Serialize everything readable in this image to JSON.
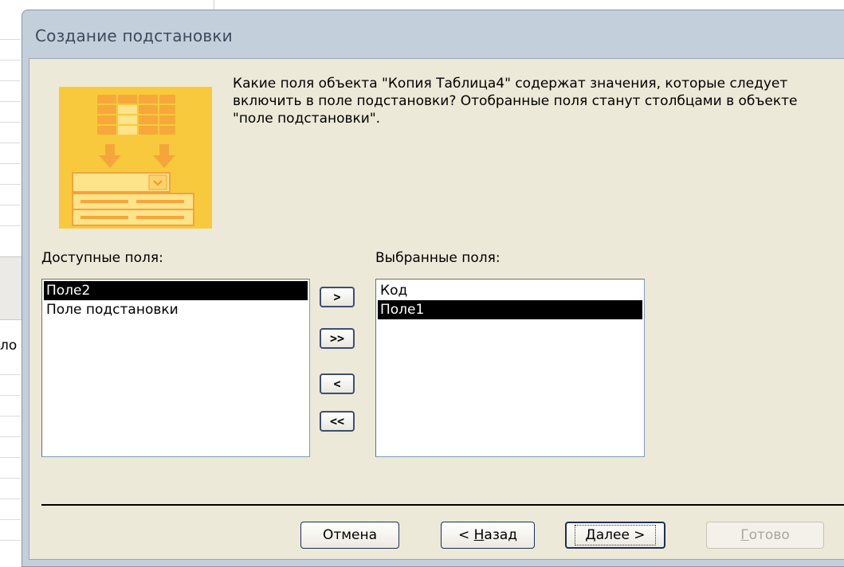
{
  "dialog": {
    "title": "Создание подстановки",
    "question": "Какие поля объекта \"Копия Таблица4\" содержат значения, которые следует включить в поле подстановки? Отобранные поля станут столбцами в объекте \"поле подстановки\"."
  },
  "available": {
    "label": "Доступные поля:",
    "items": [
      "Поле2",
      "Поле подстановки"
    ],
    "selected_index": 0
  },
  "selected": {
    "label": "Выбранные поля:",
    "items": [
      "Код",
      "Поле1"
    ],
    "selected_index": 1
  },
  "move_buttons": {
    "add_one": ">",
    "add_all": ">>",
    "remove_one": "<",
    "remove_all": "<<"
  },
  "buttons": {
    "cancel": "Отмена",
    "back_prefix": "< ",
    "back_hotkey": "Н",
    "back_rest": "азад",
    "next_hotkey": "Д",
    "next_rest": "алее >",
    "finish_hotkey": "Г",
    "finish_rest": "отово"
  },
  "background": {
    "fragment_text": "ло"
  },
  "colors": {
    "wizard_image": "#f9c93d",
    "selection": "#000000",
    "dialog_face": "#ece9d8"
  }
}
